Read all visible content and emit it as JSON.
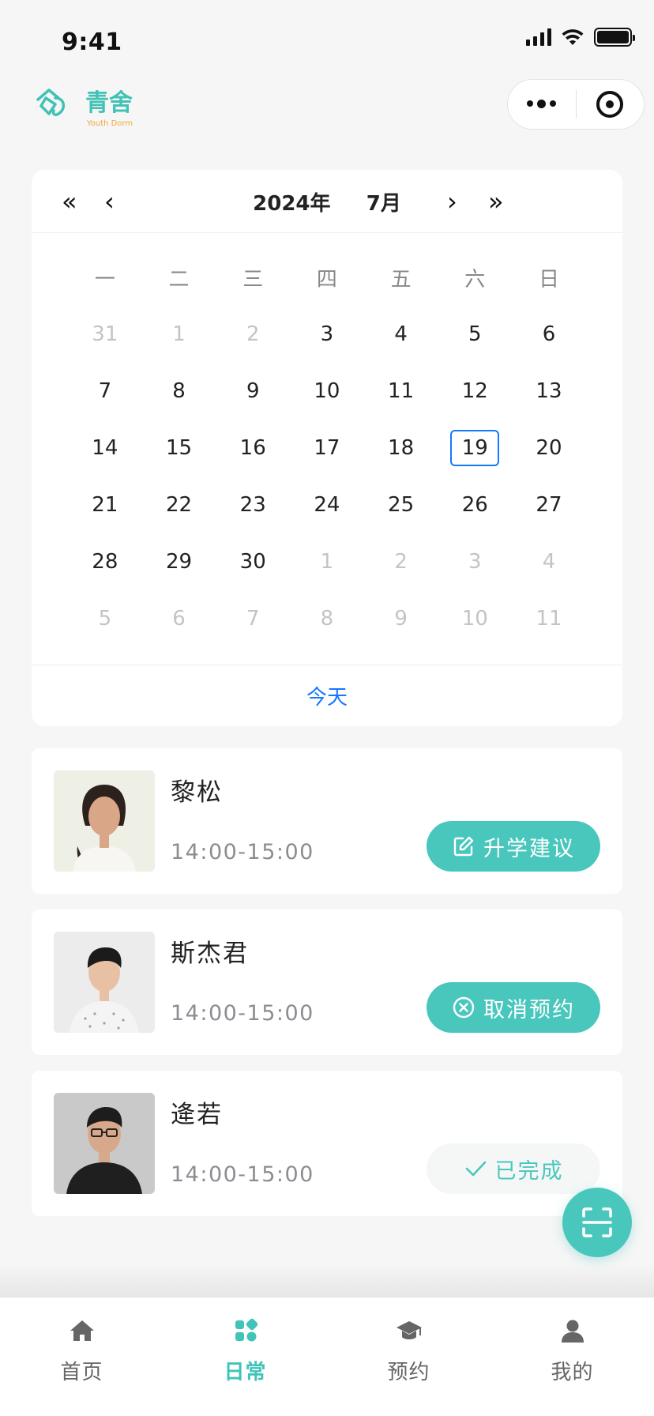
{
  "status_bar": {
    "time": "9:41"
  },
  "header": {
    "logo_text": "青舍",
    "logo_subtext": "Youth Dorm"
  },
  "calendar": {
    "nav": {
      "prev_year": "«",
      "prev_month": "‹",
      "next_month": "›",
      "next_year": "»"
    },
    "title": "2024年     7月",
    "weekdays": [
      "一",
      "二",
      "三",
      "四",
      "五",
      "六",
      "日"
    ],
    "weeks": [
      [
        "31",
        "1",
        "2",
        "3",
        "4",
        "5",
        "6"
      ],
      [
        "7",
        "8",
        "9",
        "10",
        "11",
        "12",
        "13"
      ],
      [
        "14",
        "15",
        "16",
        "17",
        "18",
        "19",
        "20"
      ],
      [
        "21",
        "22",
        "23",
        "24",
        "25",
        "26",
        "27"
      ],
      [
        "28",
        "29",
        "30",
        "1",
        "2",
        "3",
        "4"
      ],
      [
        "5",
        "6",
        "7",
        "8",
        "9",
        "10",
        "11"
      ]
    ],
    "selected_day": "19",
    "today_label": "今天"
  },
  "appointments": [
    {
      "name": "黎松",
      "time": "14:00-15:00",
      "action": "升学建议",
      "icon": "edit-icon"
    },
    {
      "name": "斯杰君",
      "time": "14:00-15:00",
      "action": "取消预约",
      "icon": "cancel-circle-icon"
    },
    {
      "name": "逄若",
      "time": "14:00-15:00",
      "action": "已完成",
      "icon": "check-icon"
    }
  ],
  "tabbar": {
    "items": [
      {
        "label": "首页",
        "icon": "home-icon"
      },
      {
        "label": "日常",
        "icon": "apps-icon"
      },
      {
        "label": "预约",
        "icon": "graduation-cap-icon"
      },
      {
        "label": "我的",
        "icon": "user-icon"
      }
    ],
    "active": "日常"
  },
  "colors": {
    "accent": "#49c7bd",
    "link": "#1677ff",
    "background": "#f6f6f6"
  }
}
